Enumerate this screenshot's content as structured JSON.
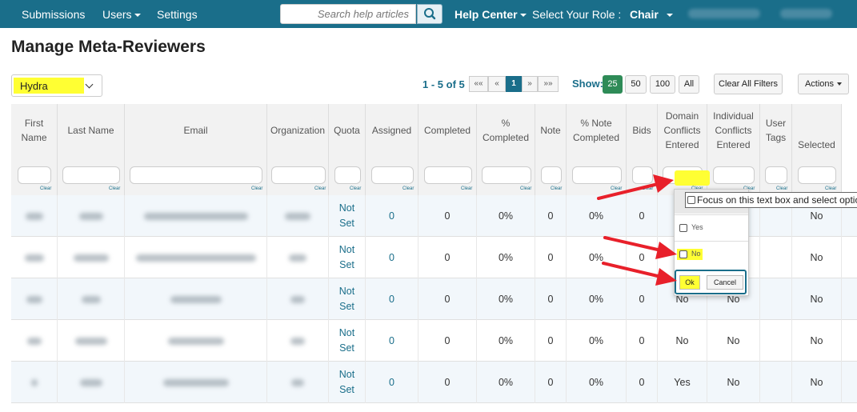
{
  "nav": {
    "submissions": "Submissions",
    "users": "Users",
    "settings": "Settings",
    "search_placeholder": "Search help articles",
    "help_center": "Help Center",
    "role_label": "Select Your Role :",
    "role_value": "Chair"
  },
  "page_title": "Manage Meta-Reviewers",
  "conference_select": "Hydra",
  "pager": {
    "range": "1 - 5 of 5",
    "first": "««",
    "prev": "«",
    "current": "1",
    "next": "»",
    "last": "»»"
  },
  "show": {
    "label": "Show:",
    "options": [
      "25",
      "50",
      "100",
      "All"
    ]
  },
  "clear_filters": "Clear All Filters",
  "actions": "Actions",
  "columns": [
    {
      "key": "first_name",
      "label": "First Name"
    },
    {
      "key": "last_name",
      "label": "Last Name"
    },
    {
      "key": "email",
      "label": "Email"
    },
    {
      "key": "organization",
      "label": "Organization"
    },
    {
      "key": "quota",
      "label": "Quota"
    },
    {
      "key": "assigned",
      "label": "Assigned"
    },
    {
      "key": "completed",
      "label": "Completed"
    },
    {
      "key": "pct_completed",
      "label": "% Completed"
    },
    {
      "key": "note",
      "label": "Note"
    },
    {
      "key": "pct_note",
      "label": "% Note Completed"
    },
    {
      "key": "bids",
      "label": "Bids"
    },
    {
      "key": "domain",
      "label": "Domain Conflicts Entered"
    },
    {
      "key": "individual",
      "label": "Individual Conflicts Entered"
    },
    {
      "key": "user_tags",
      "label": "User Tags"
    },
    {
      "key": "selected",
      "label": "Selected"
    }
  ],
  "clear_label": "Clear",
  "rows": [
    {
      "quota": "Not Set",
      "assigned": "0",
      "completed": "0",
      "pct_completed": "0%",
      "note": "0",
      "pct_note": "0%",
      "bids": "0",
      "domain": "",
      "individual": "",
      "selected": "No"
    },
    {
      "quota": "Not Set",
      "assigned": "0",
      "completed": "0",
      "pct_completed": "0%",
      "note": "0",
      "pct_note": "0%",
      "bids": "0",
      "domain": "",
      "individual": "",
      "selected": "No"
    },
    {
      "quota": "Not Set",
      "assigned": "0",
      "completed": "0",
      "pct_completed": "0%",
      "note": "0",
      "pct_note": "0%",
      "bids": "0",
      "domain": "No",
      "individual": "No",
      "selected": "No"
    },
    {
      "quota": "Not Set",
      "assigned": "0",
      "completed": "0",
      "pct_completed": "0%",
      "note": "0",
      "pct_note": "0%",
      "bids": "0",
      "domain": "No",
      "individual": "No",
      "selected": "No"
    },
    {
      "quota": "Not Set",
      "assigned": "0",
      "completed": "0",
      "pct_completed": "0%",
      "note": "0",
      "pct_note": "0%",
      "bids": "0",
      "domain": "Yes",
      "individual": "No",
      "selected": "No"
    }
  ],
  "filter_popup": {
    "yes": "Yes",
    "no": "No",
    "ok": "Ok",
    "cancel": "Cancel"
  },
  "tooltip": "Focus on this text box and select optio",
  "colors": {
    "navbar": "#1a6e8a",
    "highlight": "#ffff33",
    "annotation_arrow": "#e8202a",
    "active_show": "#2e8b57"
  }
}
